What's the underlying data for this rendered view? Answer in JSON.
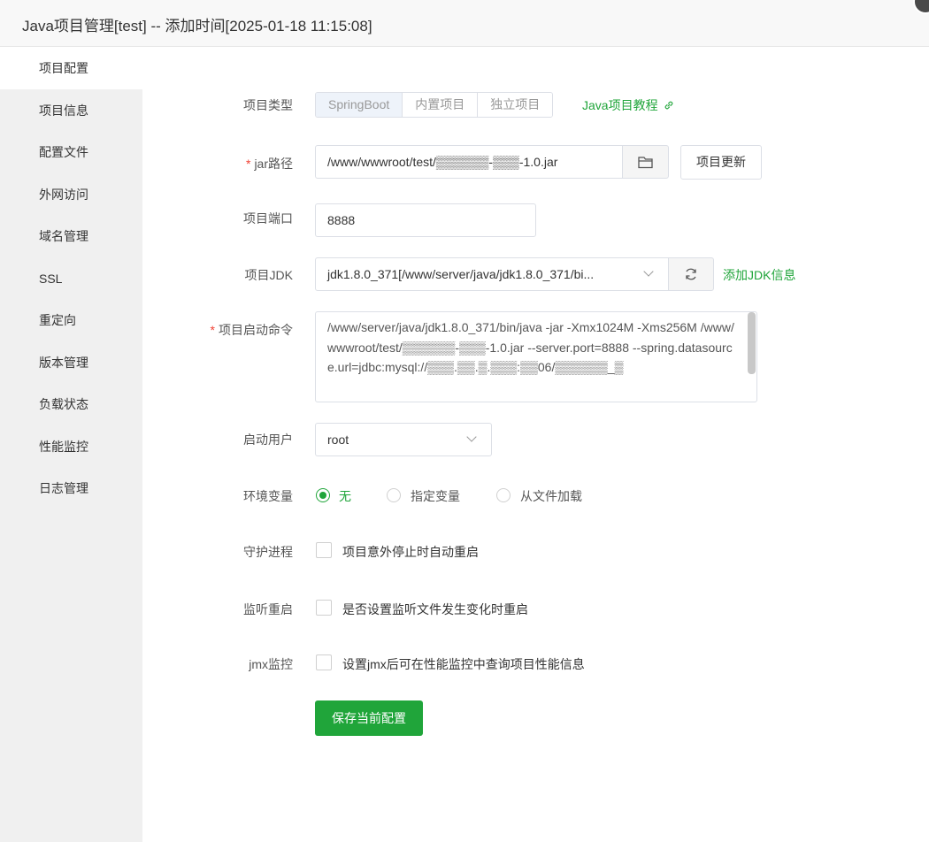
{
  "window": {
    "title": "Java项目管理[test] -- 添加时间[2025-01-18 11:15:08]"
  },
  "sidebar": {
    "items": [
      {
        "label": "项目配置"
      },
      {
        "label": "项目信息"
      },
      {
        "label": "配置文件"
      },
      {
        "label": "外网访问"
      },
      {
        "label": "域名管理"
      },
      {
        "label": "SSL"
      },
      {
        "label": "重定向"
      },
      {
        "label": "版本管理"
      },
      {
        "label": "负载状态"
      },
      {
        "label": "性能监控"
      },
      {
        "label": "日志管理"
      }
    ]
  },
  "form": {
    "project_type": {
      "label": "项目类型",
      "options": [
        "SpringBoot",
        "内置项目",
        "独立项目"
      ],
      "tutorial_link": "Java项目教程"
    },
    "jar_path": {
      "label": "jar路径",
      "value": "/www/wwwroot/test/▒▒▒▒▒▒-▒▒▒-1.0.jar",
      "update_button": "项目更新"
    },
    "port": {
      "label": "项目端口",
      "value": "8888"
    },
    "jdk": {
      "label": "项目JDK",
      "value": "jdk1.8.0_371[/www/server/java/jdk1.8.0_371/bi...",
      "add_link": "添加JDK信息"
    },
    "start_command": {
      "label": "项目启动命令",
      "value": "/www/server/java/jdk1.8.0_371/bin/java -jar  -Xmx1024M -Xms256M /www/wwwroot/test/▒▒▒▒▒▒-▒▒▒-1.0.jar --server.port=8888 --spring.datasource.url=jdbc:mysql://▒▒▒.▒▒.▒.▒▒▒:▒▒06/▒▒▒▒▒▒_▒"
    },
    "run_user": {
      "label": "启动用户",
      "value": "root"
    },
    "env": {
      "label": "环境变量",
      "options": [
        {
          "text": "无",
          "selected": true
        },
        {
          "text": "指定变量",
          "selected": false
        },
        {
          "text": "从文件加载",
          "selected": false
        }
      ]
    },
    "daemon": {
      "label": "守护进程",
      "checkbox_text": "项目意外停止时自动重启"
    },
    "watch_restart": {
      "label": "监听重启",
      "checkbox_text": "是否设置监听文件发生变化时重启"
    },
    "jmx": {
      "label": "jmx监控",
      "checkbox_text": "设置jmx后可在性能监控中查询项目性能信息"
    },
    "save_button": "保存当前配置"
  },
  "colors": {
    "accent": "#20a53a",
    "required": "#f04134"
  }
}
